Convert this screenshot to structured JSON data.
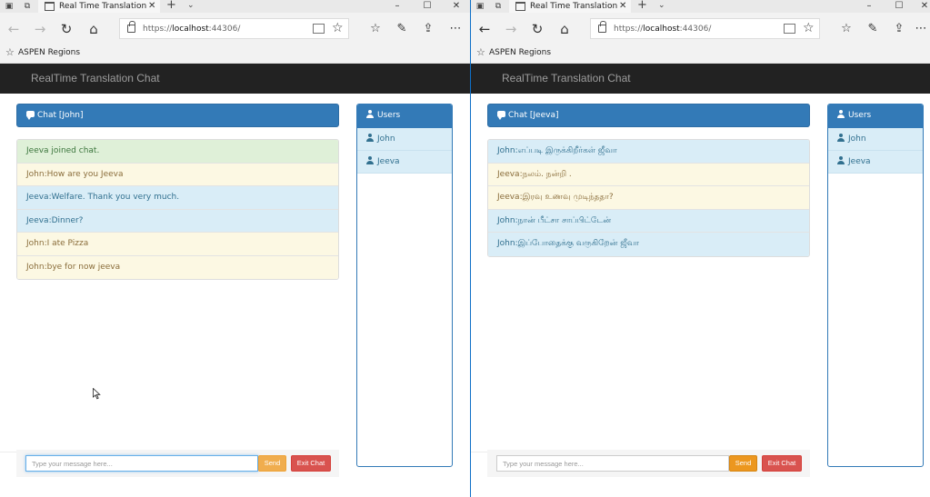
{
  "left": {
    "tab_title": "Real Time Translation Cl",
    "url_prefix": "https://",
    "url_host": "localhost",
    "url_rest": ":44306/",
    "favorite": "ASPEN Regions",
    "brand": "RealTime Translation Chat",
    "chat_title": "Chat [John]",
    "messages": [
      {
        "text": "Jeeva joined chat.",
        "style": "success"
      },
      {
        "text": "John:How are you Jeeva",
        "style": "warning"
      },
      {
        "text": "Jeeva:Welfare. Thank you very much.",
        "style": "info"
      },
      {
        "text": "Jeeva:Dinner?",
        "style": "info"
      },
      {
        "text": "John:I ate Pizza",
        "style": "warning"
      },
      {
        "text": "John:bye for now jeeva",
        "style": "warning"
      }
    ],
    "users_title": "Users",
    "users": [
      "John",
      "Jeeva"
    ],
    "input_placeholder": "Type your message here...",
    "send_label": "Send",
    "exit_label": "Exit Chat"
  },
  "right": {
    "tab_title": "Real Time Translation Cl",
    "url_prefix": "https://",
    "url_host": "localhost",
    "url_rest": ":44306/",
    "favorite": "ASPEN Regions",
    "brand": "RealTime Translation Chat",
    "chat_title": "Chat [Jeeva]",
    "messages": [
      {
        "text": "John:எப்படி இருக்கிறீர்கள் ஜீவா",
        "style": "info"
      },
      {
        "text": "Jeeva:நலம். நன்றி .",
        "style": "warning"
      },
      {
        "text": "Jeeva:இரவு உணவு முடிந்ததா?",
        "style": "warning"
      },
      {
        "text": "John:நான் பீட்சா சாப்பிட்டேன்",
        "style": "info"
      },
      {
        "text": "John:இப்போதைக்கு வருகிறேன் ஜீவா",
        "style": "info"
      }
    ],
    "users_title": "Users",
    "users": [
      "John",
      "Jeeva"
    ],
    "input_placeholder": "Type your message here...",
    "send_label": "Send",
    "exit_label": "Exit Chat"
  },
  "colors": {
    "primary": "#337ab7",
    "navbar": "#222222",
    "success_bg": "#dff0d8",
    "warning_bg": "#fcf8e3",
    "info_bg": "#d9edf7",
    "send": "#f0ad4e",
    "exit": "#d9534f"
  },
  "icons": {
    "tab_actions": "tab-actions-icon",
    "tab_preview": "tab-preview-icon",
    "page": "page-icon",
    "back": "back-arrow-icon",
    "forward": "forward-arrow-icon",
    "refresh": "refresh-icon",
    "home": "home-icon",
    "lock": "lock-icon",
    "favorites": "star-icon",
    "hub": "favorites-hub-icon",
    "notes": "pen-icon",
    "share": "share-icon",
    "more": "more-icon",
    "chat": "comment-icon",
    "user": "user-icon"
  }
}
